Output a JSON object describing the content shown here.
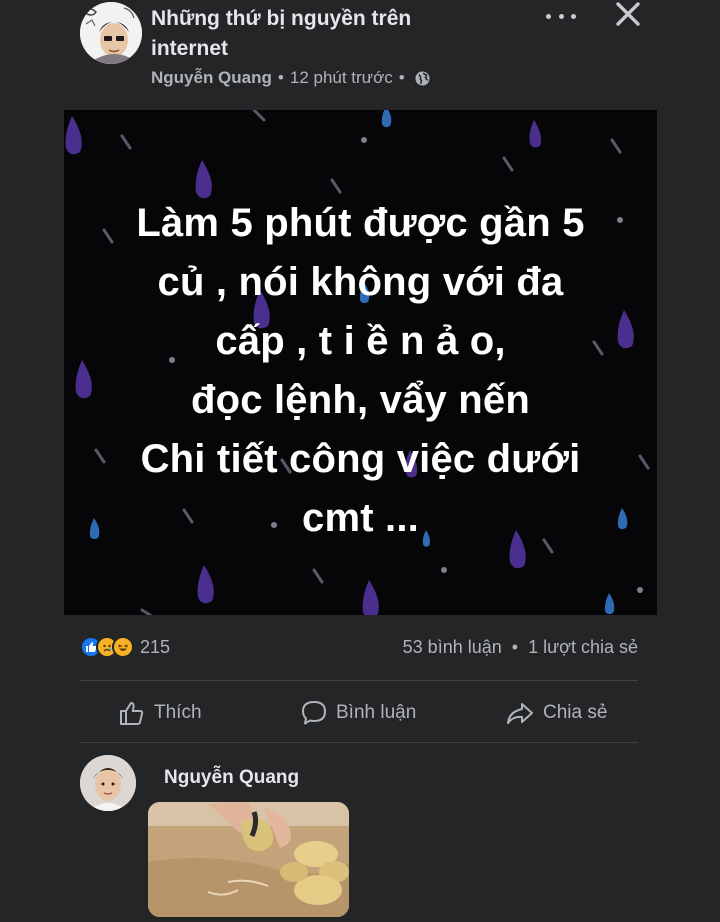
{
  "group": {
    "name": "Những thứ bị nguyền trên internet",
    "avatar_icon": "meme-avatar-icon"
  },
  "post_meta": {
    "author": "Nguyễn Quang",
    "separator": "•",
    "time": "12 phút trước",
    "separator2": "•",
    "privacy_icon": "globe-icon"
  },
  "header_actions": {
    "more_icon": "more-dots-icon",
    "close_icon": "close-icon"
  },
  "post_image": {
    "lines": [
      "Làm 5 phút được gần 5",
      "củ , nói không với đa",
      "cấp , t i ề n  ả o,",
      "đọc lệnh, vẩy nến",
      "Chi tiết công việc dưới",
      "cmt ..."
    ],
    "background": "#060608",
    "drop_colors": [
      "#4b2f8f",
      "#2f6bb5",
      "#3a3f4a"
    ]
  },
  "reactions": {
    "icons": [
      "like-reaction-icon",
      "sad-reaction-icon",
      "haha-reaction-icon"
    ],
    "count": "215"
  },
  "stats": {
    "comments": "53 bình luận",
    "separator": "•",
    "shares": "1 lượt chia sẻ"
  },
  "actions": {
    "like_label": "Thích",
    "comment_label": "Bình luận",
    "share_label": "Chia sẻ"
  },
  "comment": {
    "author": "Nguyễn Quang"
  },
  "colors": {
    "background": "#242526",
    "primary_text": "#e4e6eb",
    "secondary_text": "#b0b3b8",
    "divider": "#3e4042"
  }
}
